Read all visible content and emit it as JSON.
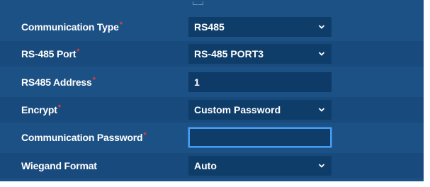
{
  "form": {
    "rows": [
      {
        "label": "Communication Type",
        "required": "*",
        "value": "RS485",
        "kind": "select"
      },
      {
        "label": "RS-485 Port",
        "required": "*",
        "value": "RS-485 PORT3",
        "kind": "select"
      },
      {
        "label": "RS485 Address",
        "required": "*",
        "value": "1",
        "kind": "input"
      },
      {
        "label": "Encrypt",
        "required": "*",
        "value": "Custom Password",
        "kind": "select"
      },
      {
        "label": "Communication Password",
        "required": "*",
        "value": "",
        "kind": "input-focused"
      },
      {
        "label": "Wiegand Format",
        "required": "",
        "value": "Auto",
        "kind": "select"
      }
    ]
  },
  "icons": {
    "select_arrow": "chevron-down-icon"
  },
  "colors": {
    "panel_bg": "#1c5186",
    "control_bg": "#0f3d6a",
    "required_mark": "#e0413a",
    "focus_border": "#4a9cf0"
  }
}
